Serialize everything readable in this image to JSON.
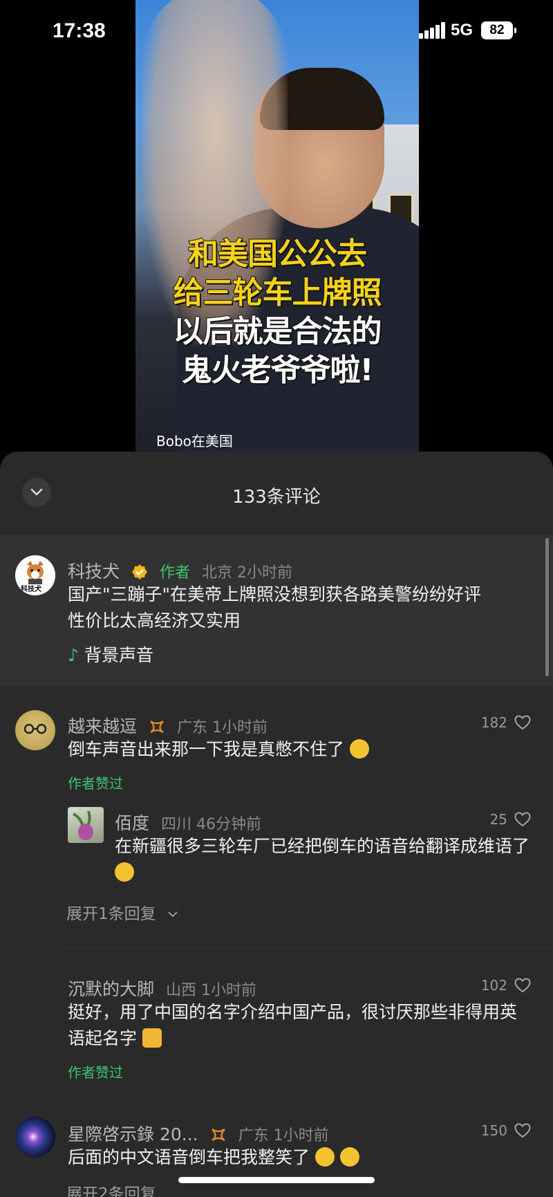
{
  "status": {
    "time": "17:38",
    "network": "5G",
    "battery": "82"
  },
  "video": {
    "caption": [
      "和美国公公去",
      "给三轮车上牌照",
      "以后就是合法的",
      "鬼火老爷爷啦!"
    ],
    "watermark": "Bobo在美国"
  },
  "comments_sheet": {
    "title": "133条评论",
    "pinned": {
      "avatar_text": "科技犬",
      "name": "科技犬",
      "author_tag": "作者",
      "meta": "北京 2小时前",
      "text": "国产\"三蹦子\"在美帝上牌照没想到获各路美警纷纷好评性价比太高经济又实用",
      "music_label": "背景声音"
    },
    "comments": [
      {
        "name": "越来越逗",
        "meta": "广东 1小时前",
        "likes": "182",
        "text": "倒车声音出来那一下我是真憋不住了",
        "liked_by_author": "作者赞过",
        "reply": {
          "name": "佰度",
          "meta": "四川 46分钟前",
          "likes": "25",
          "text": "在新疆很多三轮车厂已经把倒车的语音给翻译成维语了"
        },
        "expand": "展开1条回复"
      },
      {
        "name": "沉默的大脚",
        "meta": "山西 1小时前",
        "likes": "102",
        "text": "挺好，用了中国的名字介绍中国产品，很讨厌那些非得用英语起名字",
        "liked_by_author": "作者赞过"
      },
      {
        "name": "星際啓示錄 20...",
        "meta": "广东 1小时前",
        "likes": "150",
        "text": "后面的中文语音倒车把我整笑了",
        "expand": "展开2条回复"
      }
    ]
  }
}
